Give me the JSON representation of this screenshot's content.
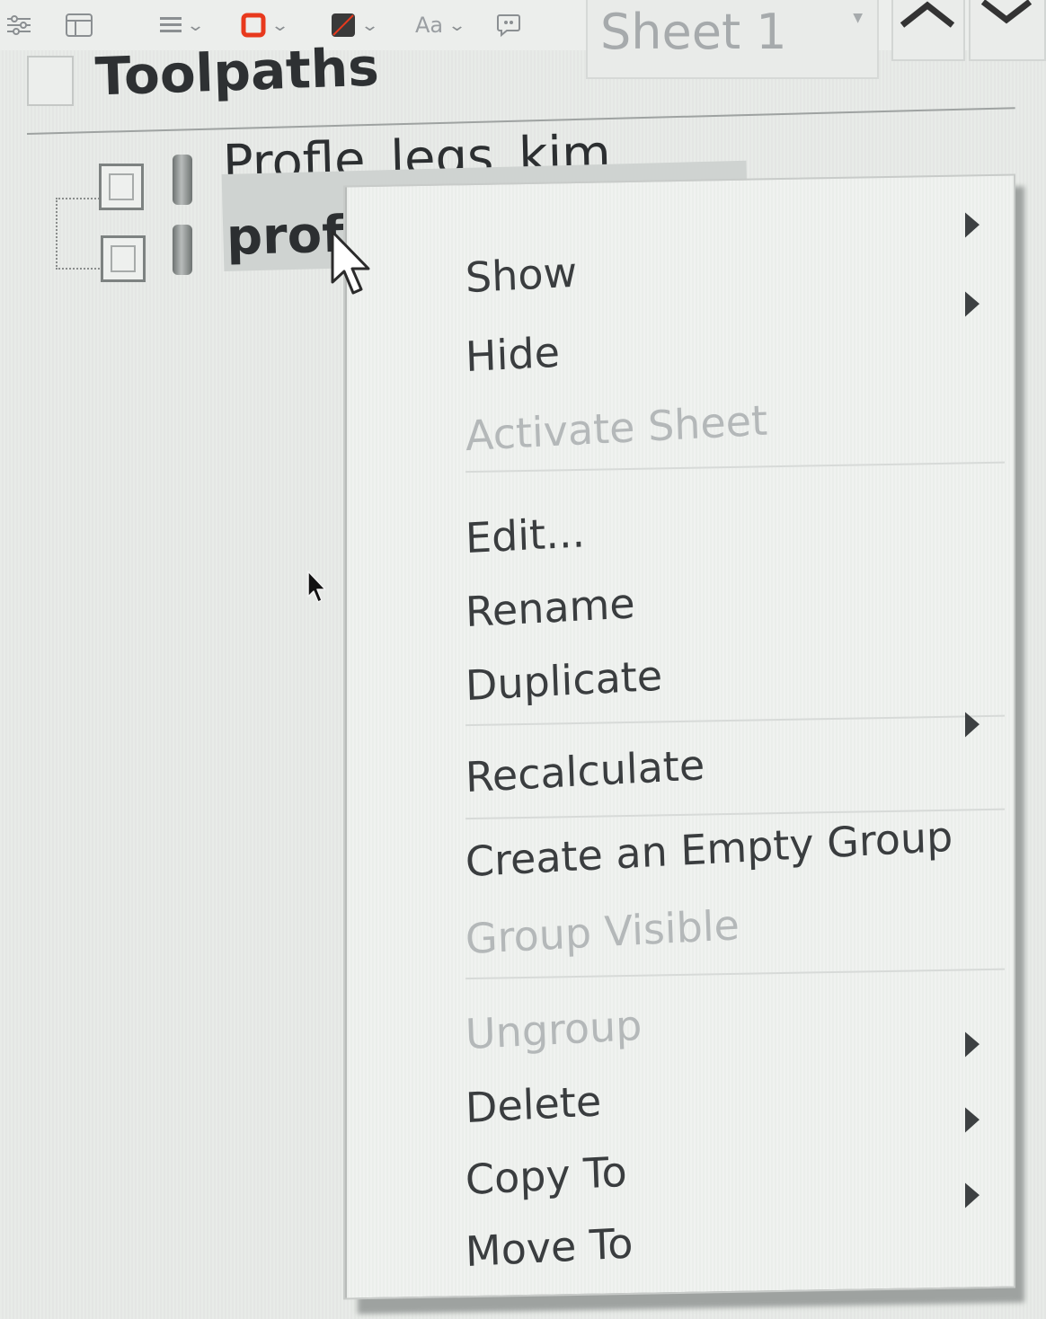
{
  "toolbar": {
    "icons": [
      "sliders-icon",
      "layout-icon",
      "align-icon",
      "stroke-color-icon",
      "fill-color-icon",
      "text-style-icon",
      "comment-icon"
    ],
    "text_style_label": "Aa",
    "stroke_color": "#e8391d",
    "fill_color": "#3a3a3a",
    "sheet_selector": {
      "value": "Sheet 1"
    }
  },
  "tree": {
    "root": {
      "label": "Toolpaths"
    },
    "items": [
      {
        "label": "Profle_legs_kim",
        "selected": false
      },
      {
        "label": "profile_plant_inside_kim",
        "selected": true
      }
    ]
  },
  "context_menu": {
    "items": [
      {
        "label": "Show",
        "enabled": true
      },
      {
        "label": "Hide",
        "enabled": true
      },
      {
        "label": "Activate Sheet",
        "enabled": false
      },
      {
        "label": "Edit...",
        "enabled": true
      },
      {
        "label": "Rename",
        "enabled": true
      },
      {
        "label": "Duplicate",
        "enabled": true
      },
      {
        "label": "Recalculate",
        "enabled": true
      },
      {
        "label": "Create an Empty Group",
        "enabled": true
      },
      {
        "label": "Group Visible",
        "enabled": false
      },
      {
        "label": "Ungroup",
        "enabled": false
      },
      {
        "label": "Delete",
        "enabled": true
      },
      {
        "label": "Copy To",
        "enabled": true
      },
      {
        "label": "Move To",
        "enabled": true
      }
    ]
  }
}
